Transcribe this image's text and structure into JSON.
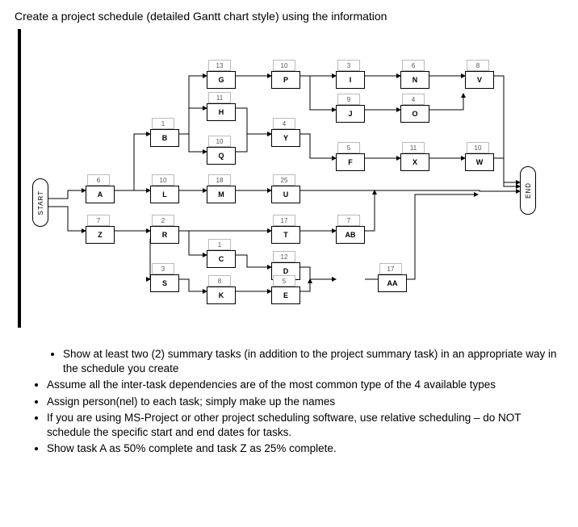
{
  "title": "Create a project schedule (detailed Gantt chart style) using the information",
  "caps": {
    "start": "START",
    "end": "END"
  },
  "nodes": {
    "A": "A",
    "Z": "Z",
    "B": "B",
    "L": "L",
    "R": "R",
    "S": "S",
    "G": "G",
    "H": "H",
    "Q": "Q",
    "M": "M",
    "C": "C",
    "K": "K",
    "P": "P",
    "Y": "Y",
    "U": "U",
    "T": "T",
    "D": "D",
    "E": "E",
    "I": "I",
    "J": "J",
    "F": "F",
    "AB": "AB",
    "AA": "AA",
    "N": "N",
    "O": "O",
    "X": "X",
    "V": "V",
    "W": "W"
  },
  "dur": {
    "dA": "6",
    "dZ": "7",
    "dB": "1",
    "dL": "10",
    "dR": "2",
    "dS": "3",
    "dG": "13",
    "dH": "11",
    "dQ": "10",
    "dM": "18",
    "dC": "1",
    "dK": "8",
    "dP": "10",
    "dY": "4",
    "dU": "25",
    "dT": "17",
    "dD": "12",
    "dE": "5",
    "dI": "3",
    "dJ": "9",
    "dF": "5",
    "dAB": "7",
    "dAA": "17",
    "dN": "6",
    "dO": "4",
    "dX": "11",
    "dV": "8",
    "dW": "10"
  },
  "bullets": {
    "b1a": "Show at least two (2) summary tasks (in addition to the project summary task) in an appropriate way in",
    "b1b": "the schedule you create",
    "b2": "Assume all the inter-task dependencies are of the most common type of the 4 available types",
    "b3": "Assign person(nel) to each task; simply make up the names",
    "b4a": "If you are using MS-Project or other project scheduling software, use relative scheduling – do NOT",
    "b4b": "schedule the specific start and end dates for tasks.",
    "b5": "Show task A as 50% complete and task Z as 25% complete."
  }
}
